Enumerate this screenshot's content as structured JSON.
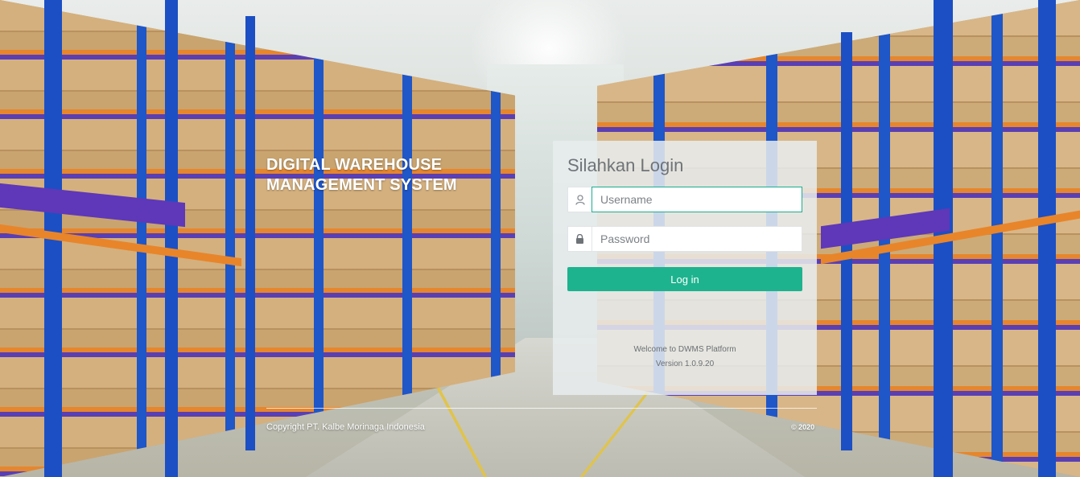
{
  "brand": {
    "line1": "DIGITAL WAREHOUSE",
    "line2": "MANAGEMENT SYSTEM"
  },
  "login": {
    "title": "Silahkan Login",
    "username_placeholder": "Username",
    "password_placeholder": "Password",
    "username_icon": "user-icon",
    "password_icon": "lock-icon",
    "button_label": "Log in",
    "welcome_text": "Welcome to DWMS Platform",
    "version_text": "Version 1.0.9.20"
  },
  "footer": {
    "copyright": "Copyright PT. Kalbe Morinaga Indonesia",
    "year": "© 2020"
  },
  "colors": {
    "accent": "#1db38e",
    "focus_border": "#1aae91"
  }
}
